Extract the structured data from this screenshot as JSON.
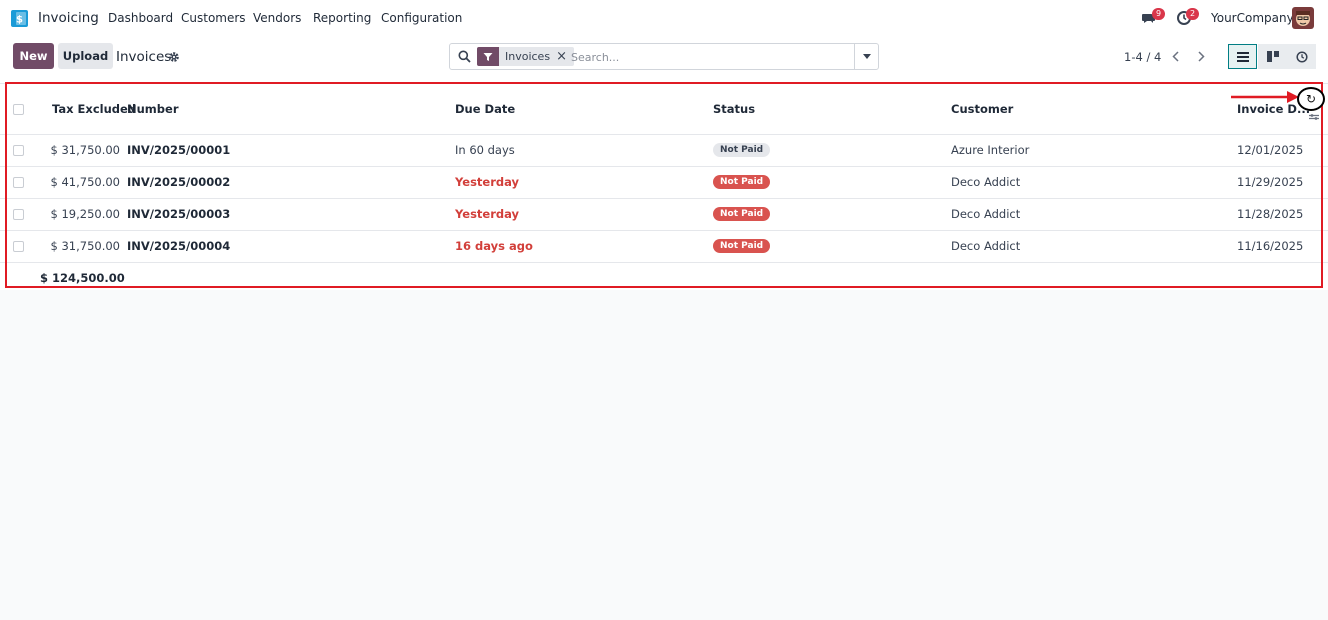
{
  "navbar": {
    "app_name": "Invoicing",
    "menu": [
      "Dashboard",
      "Customers",
      "Vendors",
      "Reporting",
      "Configuration"
    ],
    "messages_count": "9",
    "activities_count": "2",
    "company": "YourCompany"
  },
  "control_panel": {
    "new_label": "New",
    "upload_label": "Upload",
    "title": "Invoices",
    "search": {
      "facet_label": "Invoices",
      "facet_remove": "×",
      "placeholder": "Search..."
    },
    "pager": "1-4 / 4"
  },
  "table": {
    "headers": {
      "tax_excluded": "Tax Excluded",
      "number": "Number",
      "due_date": "Due Date",
      "status": "Status",
      "customer": "Customer",
      "invoice_date": "Invoice D..."
    },
    "rows": [
      {
        "tax_excluded": "$ 31,750.00",
        "number": "INV/2025/00001",
        "due_date": "In 60 days",
        "status": "Not Paid",
        "customer": "Azure Interior",
        "invoice_date": "12/01/2025"
      },
      {
        "tax_excluded": "$ 41,750.00",
        "number": "INV/2025/00002",
        "due_date": "Yesterday",
        "status": "Not Paid",
        "customer": "Deco Addict",
        "invoice_date": "11/29/2025"
      },
      {
        "tax_excluded": "$ 19,250.00",
        "number": "INV/2025/00003",
        "due_date": "Yesterday",
        "status": "Not Paid",
        "customer": "Deco Addict",
        "invoice_date": "11/28/2025"
      },
      {
        "tax_excluded": "$ 31,750.00",
        "number": "INV/2025/00004",
        "due_date": "16 days ago",
        "status": "Not Paid",
        "customer": "Deco Addict",
        "invoice_date": "11/16/2025"
      }
    ],
    "total": "$ 124,500.00"
  },
  "annotation": {
    "refresh_glyph": "↻"
  },
  "colors": {
    "brand": "#714b67",
    "late": "#d23f3a",
    "badge_red": "#d9534f",
    "highlight": "#e01b24"
  }
}
